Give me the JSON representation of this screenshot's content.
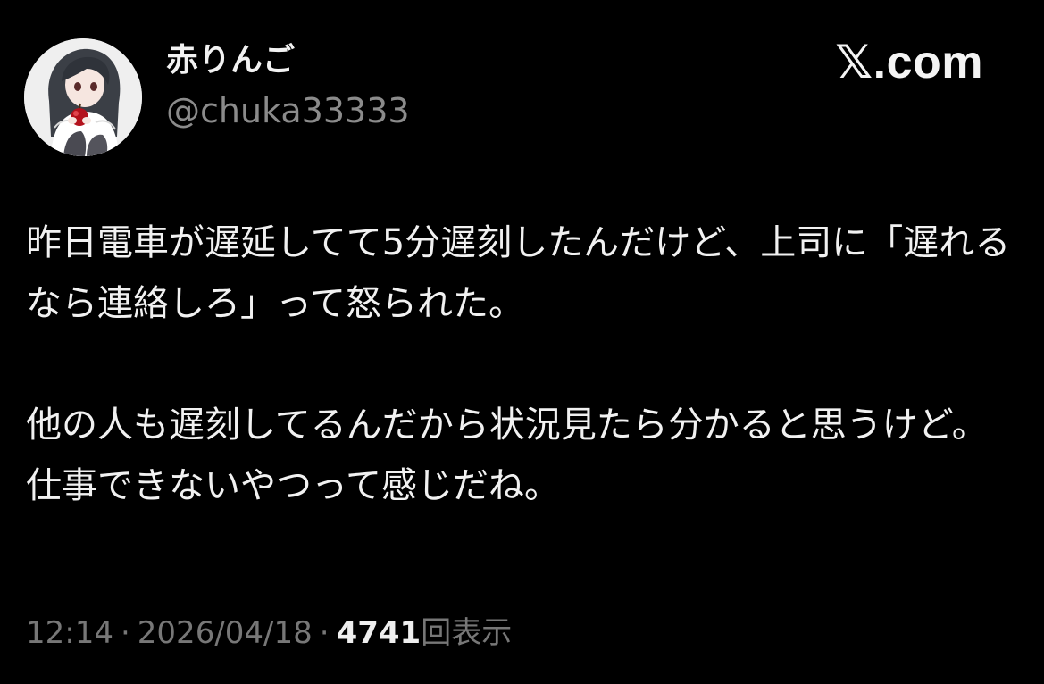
{
  "author": {
    "display_name": "赤りんご",
    "handle": "@chuka33333",
    "avatar_icon": "anime-girl-holding-apple-avatar"
  },
  "brand": {
    "label": "𝕏.com"
  },
  "post": {
    "paragraph_1": "昨日電車が遅延してて5分遅刻したんだけど、上司に「遅れるなら連絡しろ」って怒られた。",
    "paragraph_2": "他の人も遅刻してるんだから状況見たら分かると思うけど。仕事できないやつって感じだね。"
  },
  "meta": {
    "time": "12:14",
    "separator": "·",
    "date": "2026/04/18",
    "views_count": "4741",
    "views_label": "回表示"
  },
  "colors": {
    "background": "#000000",
    "text_primary": "#f1f1f1",
    "text_secondary": "#8b8b8b"
  }
}
